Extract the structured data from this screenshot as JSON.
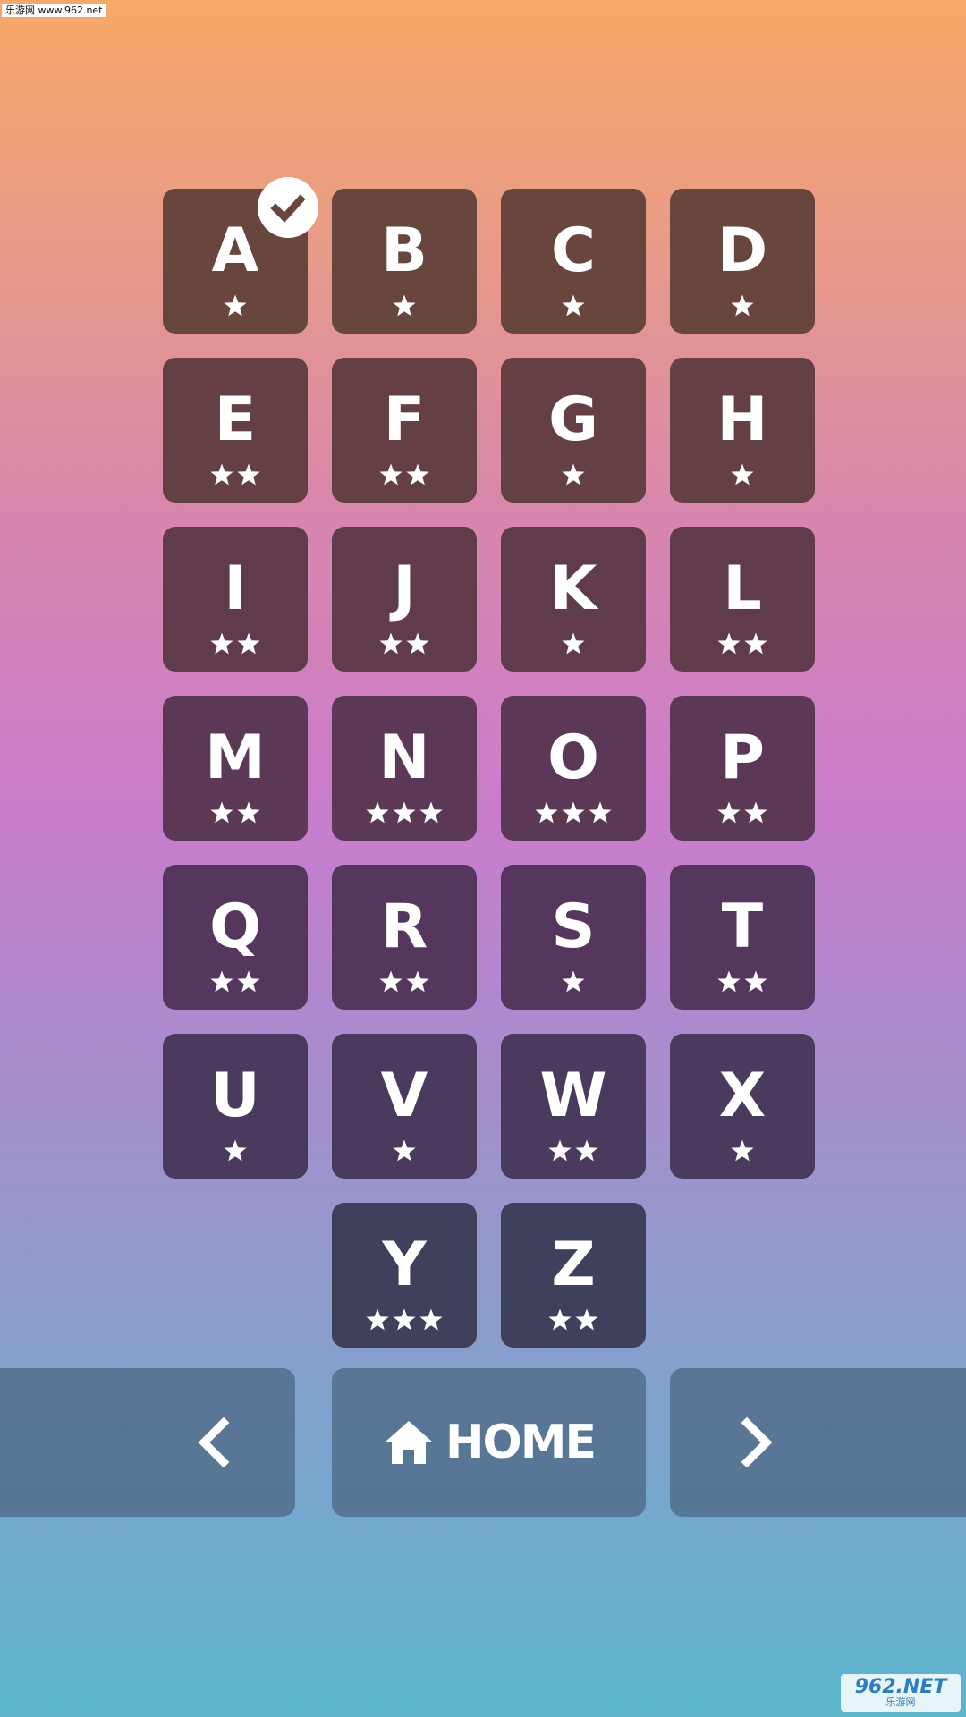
{
  "watermark": {
    "top_text": "乐游网 www.962.net",
    "bottom_main": "962.NET",
    "bottom_sub": "乐游网"
  },
  "colors": {
    "tile_row_1": "#68463d",
    "tile_row_2": "#643f43",
    "tile_row_3": "#5f3b4b",
    "tile_row_4": "#5a3856",
    "tile_row_5": "#55365d",
    "tile_row_6": "#4a3b5e",
    "tile_row_7": "#3f405b",
    "text": "#ffffff"
  },
  "levels": [
    {
      "letter": "A",
      "stars": 1,
      "completed": true
    },
    {
      "letter": "B",
      "stars": 1,
      "completed": false
    },
    {
      "letter": "C",
      "stars": 1,
      "completed": false
    },
    {
      "letter": "D",
      "stars": 1,
      "completed": false
    },
    {
      "letter": "E",
      "stars": 2,
      "completed": false
    },
    {
      "letter": "F",
      "stars": 2,
      "completed": false
    },
    {
      "letter": "G",
      "stars": 1,
      "completed": false
    },
    {
      "letter": "H",
      "stars": 1,
      "completed": false
    },
    {
      "letter": "I",
      "stars": 2,
      "completed": false
    },
    {
      "letter": "J",
      "stars": 2,
      "completed": false
    },
    {
      "letter": "K",
      "stars": 1,
      "completed": false
    },
    {
      "letter": "L",
      "stars": 2,
      "completed": false
    },
    {
      "letter": "M",
      "stars": 2,
      "completed": false
    },
    {
      "letter": "N",
      "stars": 3,
      "completed": false
    },
    {
      "letter": "O",
      "stars": 3,
      "completed": false
    },
    {
      "letter": "P",
      "stars": 2,
      "completed": false
    },
    {
      "letter": "Q",
      "stars": 2,
      "completed": false
    },
    {
      "letter": "R",
      "stars": 2,
      "completed": false
    },
    {
      "letter": "S",
      "stars": 1,
      "completed": false
    },
    {
      "letter": "T",
      "stars": 2,
      "completed": false
    },
    {
      "letter": "U",
      "stars": 1,
      "completed": false
    },
    {
      "letter": "V",
      "stars": 1,
      "completed": false
    },
    {
      "letter": "W",
      "stars": 2,
      "completed": false
    },
    {
      "letter": "X",
      "stars": 1,
      "completed": false
    },
    {
      "letter": "Y",
      "stars": 3,
      "completed": false
    },
    {
      "letter": "Z",
      "stars": 2,
      "completed": false
    }
  ],
  "nav": {
    "prev_icon": "chevron-left-icon",
    "home_icon": "home-icon",
    "home_label": "HOME",
    "next_icon": "chevron-right-icon"
  }
}
